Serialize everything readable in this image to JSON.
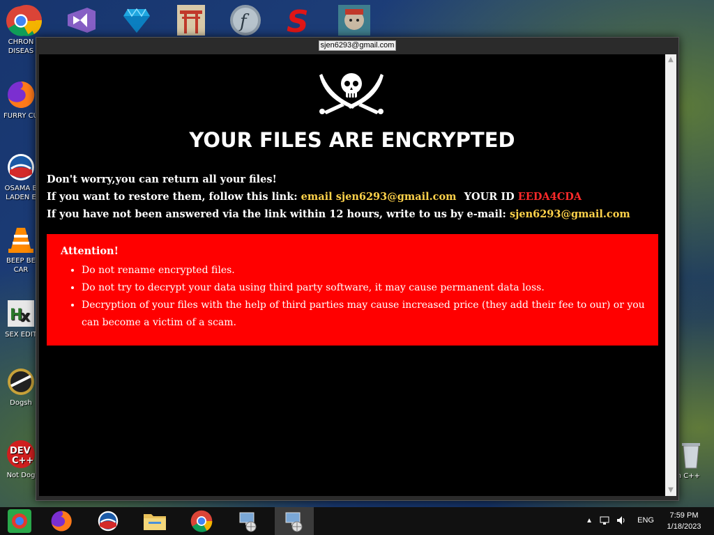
{
  "desktop": {
    "top_icons": [
      "chrome-icon",
      "visual-studio-icon",
      "diamond-icon",
      "shrine-gate-icon",
      "flash-icon",
      "s-logo-icon",
      "avatar-app-icon"
    ],
    "left_icons": [
      {
        "label": "CHRON\nDISEAS",
        "icon": "chrome-icon"
      },
      {
        "label": "FURRY CU",
        "icon": "firefox-icon"
      },
      {
        "label": "OSAMA B\nLADEN E",
        "icon": "obama-logo-icon"
      },
      {
        "label": "BEEP BE\nCAR",
        "icon": "vlc-cone-icon"
      },
      {
        "label": "SEX EDIT",
        "icon": "hex-editor-icon"
      },
      {
        "label": "Dogsh",
        "icon": "doge-icon"
      },
      {
        "label": "Not Dog",
        "icon": "dev-cpp-icon"
      }
    ],
    "right_icon_label": "n C++",
    "colors": {
      "desktop_blue": "#17356e",
      "land_green": "#4e6e34"
    }
  },
  "window": {
    "title": "sjen6293@gmail.com"
  },
  "note": {
    "heading": "YOUR FILES ARE ENCRYPTED",
    "line1": "Don't worry,you can return all your files!",
    "line2_prefix": "If you want to restore them, follow this link:",
    "line2_email": "email sjen6293@gmail.com",
    "line2_id_label": "YOUR ID",
    "line2_id": "EEDA4CDA",
    "line3_prefix": "If you have not been answered via the link within 12 hours, write to us by e-mail:",
    "line3_email": "sjen6293@gmail.com",
    "attention_title": "Attention!",
    "attention_items": [
      "Do not rename encrypted files.",
      "Do not try to decrypt your data using third party software, it may cause permanent data loss.",
      "Decryption of your files with the help of third parties may cause increased price (they add their fee to our) or you can become a victim of a scam."
    ],
    "colors": {
      "background": "#000000",
      "accent_yellow": "#ffd24a",
      "id_red": "#ff2a2a",
      "box_red": "#ff0000"
    }
  },
  "taskbar": {
    "items": [
      "start-icon",
      "firefox-icon",
      "obama-logo-icon",
      "file-explorer-icon",
      "chrome-icon",
      "network-app-icon",
      "network-app-icon"
    ],
    "language": "ENG",
    "time": "7:59 PM",
    "date": "1/18/2023"
  }
}
